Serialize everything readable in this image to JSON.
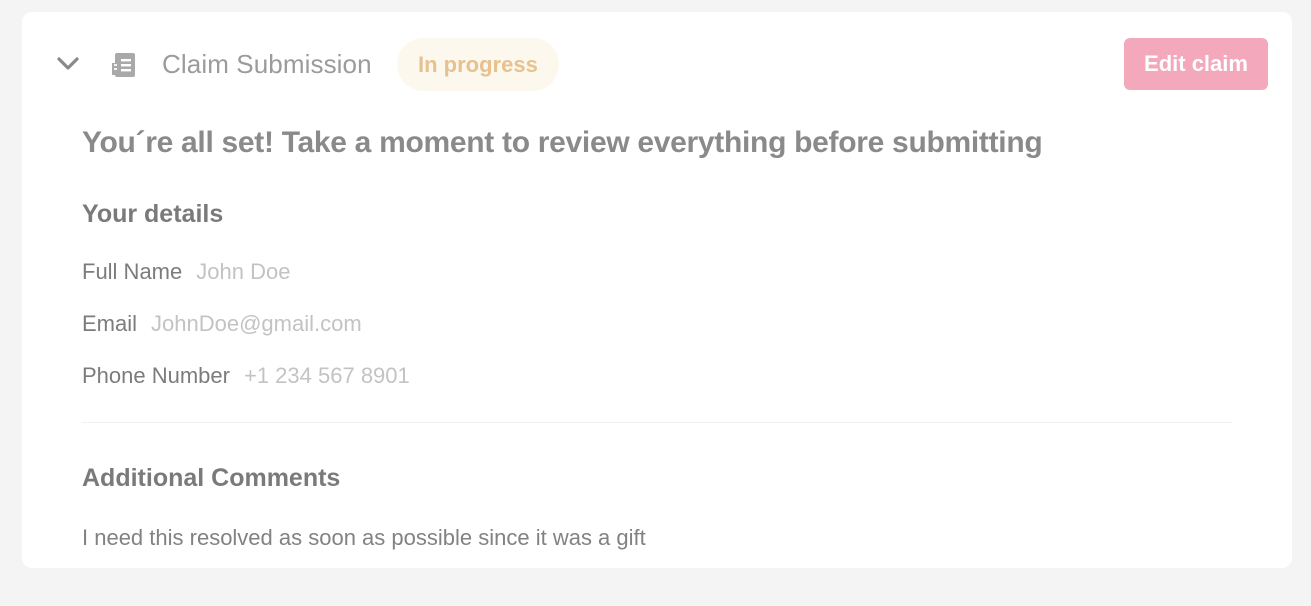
{
  "header": {
    "title": "Claim Submission",
    "status": "In progress",
    "edit_label": "Edit claim"
  },
  "review_heading": "You´re all set! Take a moment to review everything before submitting",
  "details": {
    "heading": "Your details",
    "fields": [
      {
        "label": "Full Name",
        "value": "John Doe"
      },
      {
        "label": "Email",
        "value": "JohnDoe@gmail.com"
      },
      {
        "label": "Phone Number",
        "value": "+1 234 567 8901"
      }
    ]
  },
  "comments": {
    "heading": "Additional Comments",
    "text": "I need this resolved as soon as possible since it was a gift"
  },
  "colors": {
    "accent": "#f4a8bb",
    "status_text": "#e5c290",
    "status_bg": "#fdf8ee"
  },
  "icons": {
    "collapse": "chevron-down-icon",
    "claim": "document-icon"
  }
}
